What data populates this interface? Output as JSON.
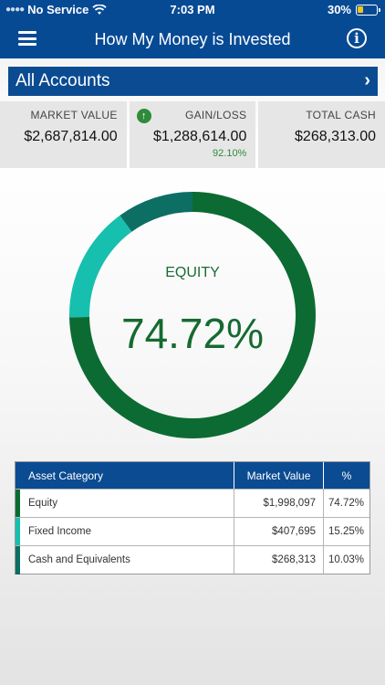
{
  "status_bar": {
    "carrier": "No Service",
    "time": "7:03 PM",
    "battery_pct": "30%",
    "battery_level": 0.3
  },
  "header": {
    "title": "How My Money is Invested"
  },
  "accounts": {
    "label": "All Accounts"
  },
  "summary": {
    "market_value": {
      "label": "MARKET VALUE",
      "value": "$2,687,814.00"
    },
    "gain_loss": {
      "label": "GAIN/LOSS",
      "value": "$1,288,614.00",
      "pct": "92.10%"
    },
    "total_cash": {
      "label": "TOTAL CASH",
      "value": "$268,313.00"
    }
  },
  "donut": {
    "label": "EQUITY",
    "value": "74.72%"
  },
  "chart_data": {
    "type": "pie",
    "categories": [
      "Equity",
      "Fixed Income",
      "Cash and Equivalents"
    ],
    "values": [
      74.72,
      15.25,
      10.03
    ],
    "colors": [
      "#0c6b32",
      "#17bfae",
      "#0d6e64"
    ]
  },
  "table": {
    "headers": [
      "Asset Category",
      "Market Value",
      "%"
    ],
    "rows": [
      {
        "category": "Equity",
        "value": "$1,998,097",
        "pct": "74.72%",
        "color": "#0c6b32"
      },
      {
        "category": "Fixed Income",
        "value": "$407,695",
        "pct": "15.25%",
        "color": "#17bfae"
      },
      {
        "category": "Cash and Equivalents",
        "value": "$268,313",
        "pct": "10.03%",
        "color": "#0d6e64"
      }
    ]
  }
}
